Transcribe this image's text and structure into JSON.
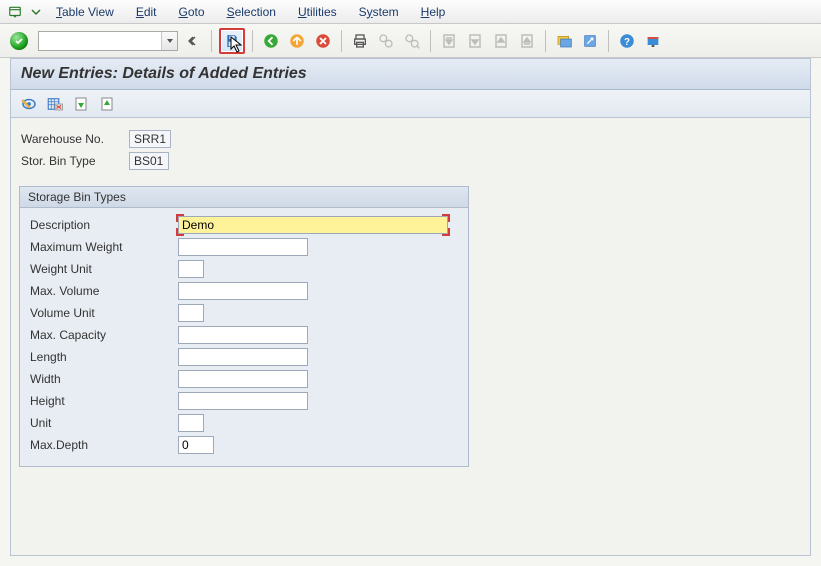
{
  "menu": {
    "items": [
      "Table View",
      "Edit",
      "Goto",
      "Selection",
      "Utilities",
      "System",
      "Help"
    ],
    "underlines": [
      "T",
      "E",
      "G",
      "S",
      "U",
      "y",
      "H"
    ]
  },
  "toolbar": {
    "command_value": ""
  },
  "page": {
    "title": "New Entries: Details of Added Entries"
  },
  "header": {
    "warehouse_label": "Warehouse No.",
    "warehouse_value": "SRR1",
    "bintype_label": "Stor. Bin Type",
    "bintype_value": "BS01"
  },
  "panel": {
    "title": "Storage Bin Types",
    "fields": {
      "description_label": "Description",
      "description_value": "Demo",
      "max_weight_label": "Maximum Weight",
      "max_weight_value": "",
      "weight_unit_label": "Weight Unit",
      "weight_unit_value": "",
      "max_volume_label": "Max. Volume",
      "max_volume_value": "",
      "volume_unit_label": "Volume Unit",
      "volume_unit_value": "",
      "max_capacity_label": "Max. Capacity",
      "max_capacity_value": "",
      "length_label": "Length",
      "length_value": "",
      "width_label": "Width",
      "width_value": "",
      "height_label": "Height",
      "height_value": "",
      "unit_label": "Unit",
      "unit_value": "",
      "max_depth_label": "Max.Depth",
      "max_depth_value": "0"
    }
  }
}
